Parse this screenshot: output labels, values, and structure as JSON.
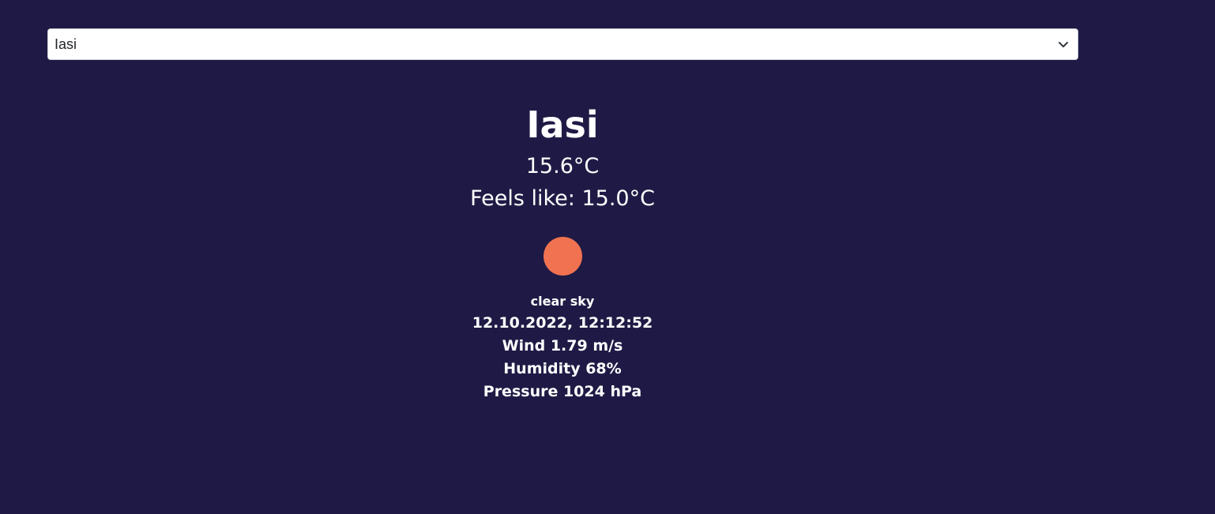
{
  "city_select": {
    "value": "Iasi"
  },
  "weather": {
    "city": "Iasi",
    "temperature": "15.6°C",
    "feels_like": "Feels like: 15.0°C",
    "icon": "sun-icon",
    "icon_color": "#f07250",
    "description": "clear sky",
    "datetime": "12.10.2022, 12:12:52",
    "wind": "Wind 1.79 m/s",
    "humidity": "Humidity 68%",
    "pressure": "Pressure 1024 hPa"
  },
  "colors": {
    "background": "#1f1a45",
    "text": "#ffffff",
    "accent": "#f07250"
  }
}
